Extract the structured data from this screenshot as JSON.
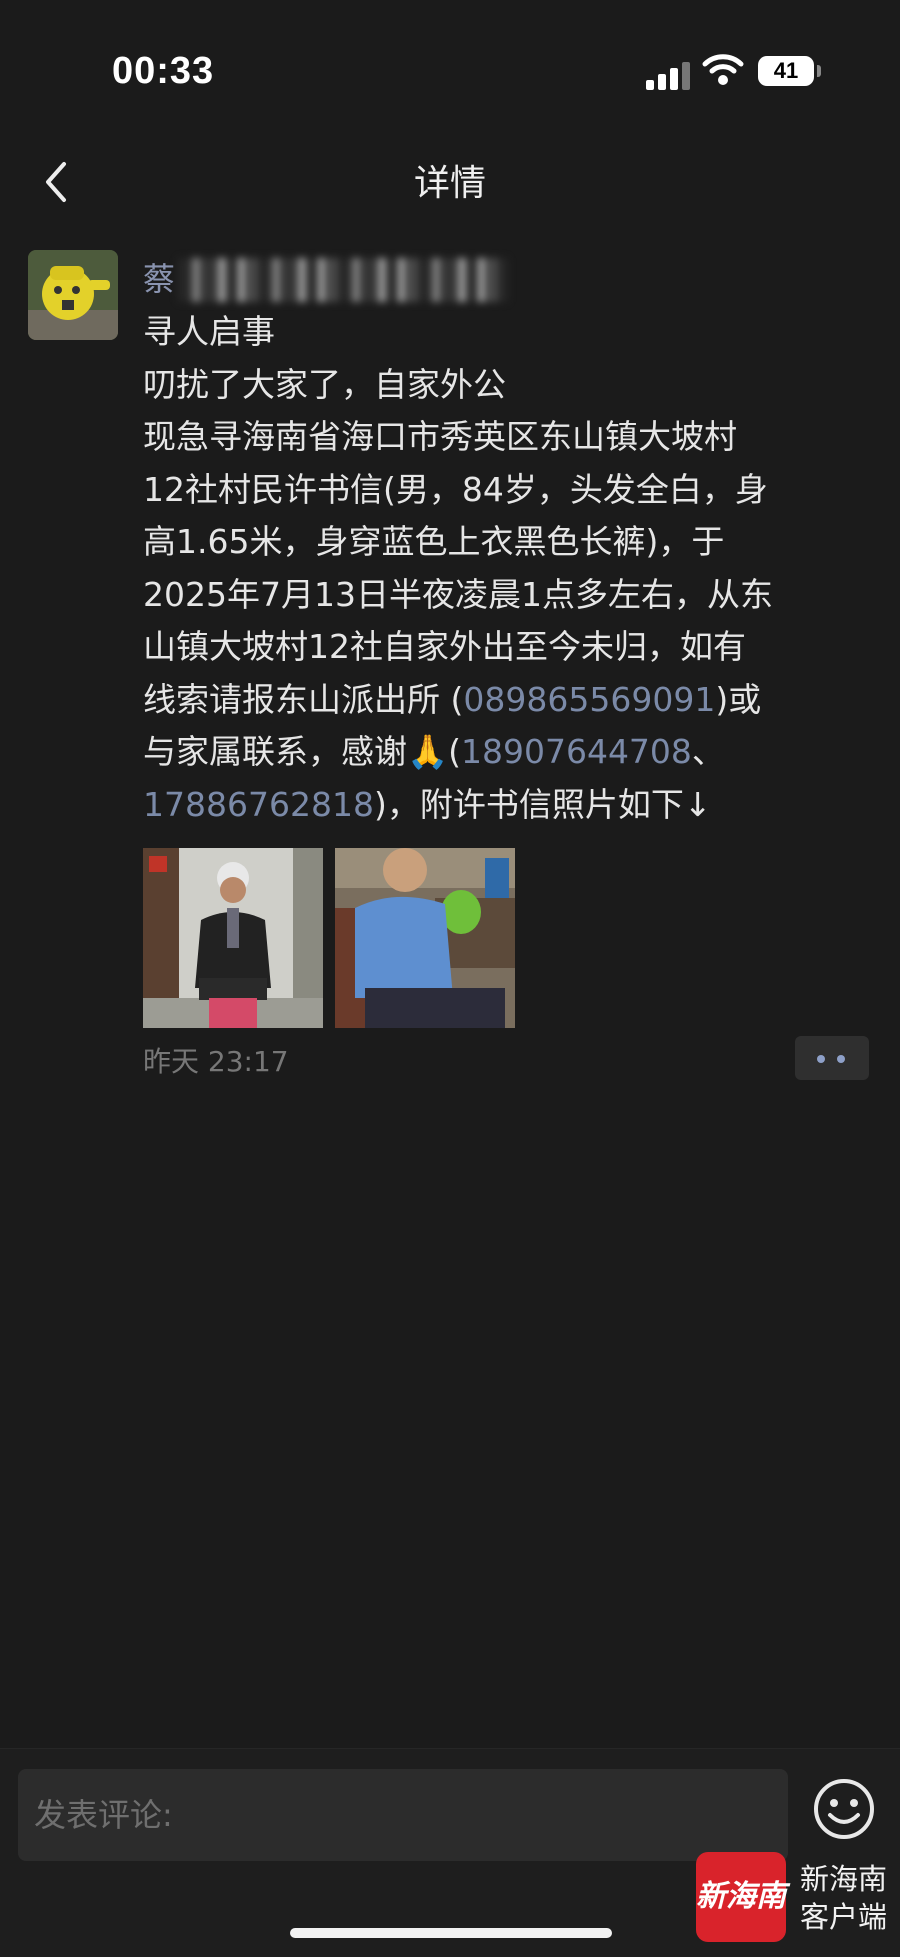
{
  "status_bar": {
    "time": "00:33",
    "battery": "41"
  },
  "nav": {
    "title": "详情"
  },
  "post": {
    "author": "蔡",
    "lines": [
      "寻人启事",
      "叨扰了大家了，自家外公",
      "现急寻海南省海口市秀英区东山镇大坡村",
      "12社村民许书信(男，84岁，头发全白，身",
      "高1.65米，身穿蓝色上衣黑色长裤)，于",
      "2025年7月13日半夜凌晨1点多左右，从东",
      "山镇大坡村12社自家外出至今未归，如有"
    ],
    "line8_pre": "线索请报东山派出所 (",
    "phone1": "089865569091",
    "line8_post": ")或",
    "line9_pre": "与家属联系，感谢",
    "line9_emoji": "🙏",
    "line9_paren": "(",
    "phone2": "18907644708",
    "line9_sep": "、",
    "phone3": "17886762818",
    "line10_post": ")，附许书信照片如下↓",
    "timestamp": "昨天 23:17"
  },
  "comment": {
    "placeholder": "发表评论:"
  },
  "watermark": {
    "logo": "新海南",
    "text_line1": "新海南",
    "text_line2": "客户端"
  },
  "colors": {
    "background": "#1b1b1b",
    "link": "#7b8aa8",
    "logo_red": "#d9232b"
  },
  "icons": [
    "back-chevron-icon",
    "signal-icon",
    "wifi-icon",
    "battery-icon",
    "more-icon",
    "emoji-smile-icon"
  ]
}
